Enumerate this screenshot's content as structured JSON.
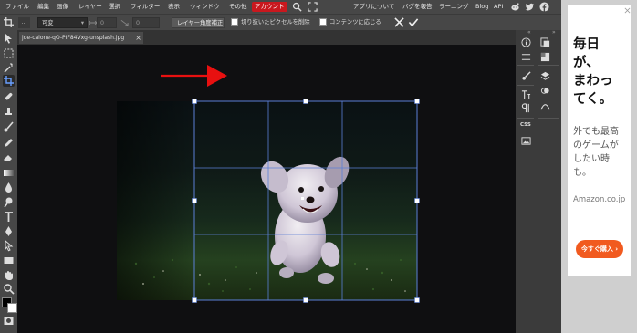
{
  "menu": {
    "items": [
      "ファイル",
      "編集",
      "画像",
      "レイヤー",
      "選択",
      "フィルター",
      "表示",
      "ウィンドウ",
      "その他",
      "アカウント"
    ],
    "active": "アカウント",
    "right_links": [
      "アプリについて",
      "バグを報告",
      "ラーニング",
      "Blog",
      "API"
    ],
    "icons": [
      "search-icon",
      "fullscreen-icon",
      "reddit-icon",
      "twitter-icon",
      "facebook-icon"
    ]
  },
  "options": {
    "aspect_select": "可変",
    "width_value": "0",
    "height_value": "0",
    "angle_button": "レイヤー角度補正",
    "checkbox_crop_pixels": "切り抜いたピクセルを削除",
    "checkbox_fit_content": "コンテンツに応じる"
  },
  "document": {
    "tab_title": "joe-caione-qO-PIF84Vxg-unsplash.jpg",
    "close_symbol": "×"
  },
  "panels": {
    "css_label": "CSS"
  },
  "ad": {
    "headline": [
      "毎日",
      "が、",
      "まわっ",
      "てく。"
    ],
    "subtext": [
      "外でも最高",
      "のゲームが",
      "したい時",
      "も。"
    ],
    "domain": "Amazon.co.jp",
    "cta": "今すぐ購入 ›"
  },
  "colors": {
    "accent_red": "#c9181e",
    "arrow_red": "#e81010",
    "crop_guide": "#5b7fd6",
    "ad_cta": "#f15a1f"
  }
}
